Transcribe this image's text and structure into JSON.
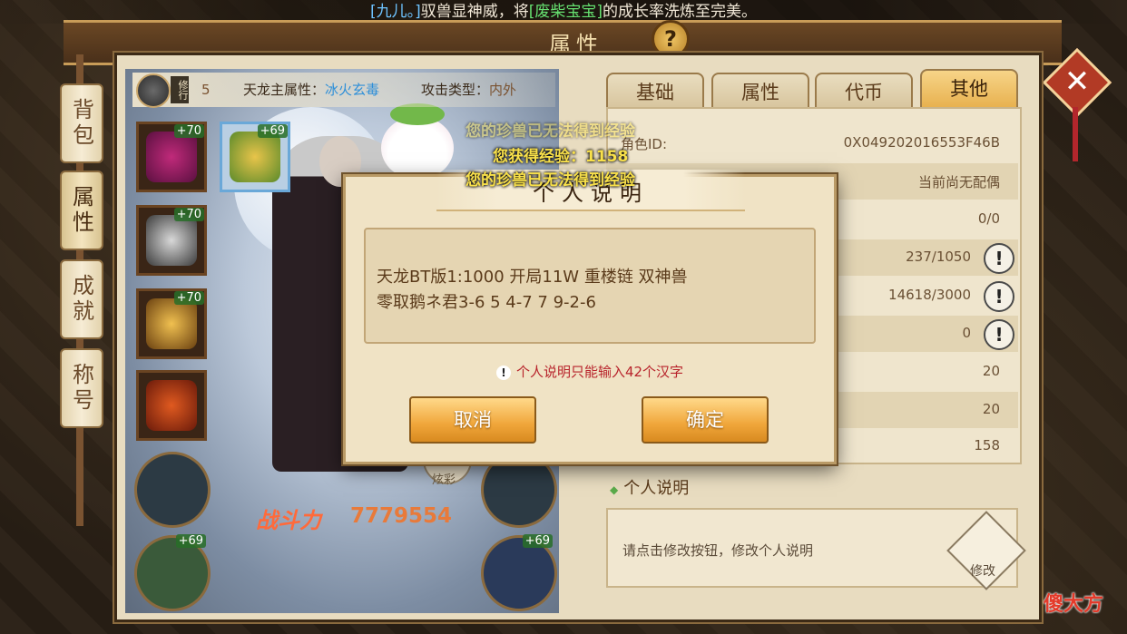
{
  "broadcast": {
    "part1": "[九儿。]",
    "part2": "驭兽显神威，将",
    "part3": "[废柴宝宝]",
    "part4": "的成长率洗炼至完美。"
  },
  "header": {
    "title": "属性"
  },
  "side_tabs": [
    "背包",
    "属性",
    "成就",
    "称号"
  ],
  "info": {
    "rank_tag": "修行",
    "rank_value": "5",
    "main_attr_label": "天龙主属性：",
    "main_attr_value": "冰火玄毒",
    "atk_type_label": "攻击类型：",
    "atk_type_value": "内外"
  },
  "equip_levels": [
    "+70",
    "+69",
    "+70",
    "+70",
    "+69",
    "+69"
  ],
  "power": {
    "label": "战斗力",
    "value": "7779554"
  },
  "skin_label": "炫彩",
  "tabs": [
    "基础",
    "属性",
    "代币",
    "其他"
  ],
  "rows": [
    {
      "label": "角色ID:",
      "value": "0X049202016553F46B"
    },
    {
      "label": "",
      "value": "当前尚无配偶"
    },
    {
      "label": "",
      "value": "0/0"
    },
    {
      "label": "",
      "value": "237/1050"
    },
    {
      "label": "",
      "value": "14618/3000"
    },
    {
      "label": "",
      "value": "0"
    },
    {
      "label": "",
      "value": "20"
    },
    {
      "label": "",
      "value": "20"
    },
    {
      "label": "",
      "value": "158"
    }
  ],
  "personal": {
    "title": "个人说明",
    "placeholder": "请点击修改按钮，修改个人说明",
    "edit_label": "修改"
  },
  "messages": {
    "faded": "您的珍兽已无法得到经验",
    "exp": "您获得经验：1158",
    "pet": "您的珍兽已无法得到经验"
  },
  "modal": {
    "title": "个人说明",
    "line1": "天龙BT版1:1000 开局11W 重楼链 双神兽",
    "line2": "零取鹅ネ君3-6 5 4-7 7 9-2-6",
    "warning": "个人说明只能输入42个汉字",
    "cancel": "取消",
    "confirm": "确定"
  },
  "watermark": "傻大方",
  "colors": {
    "accent_gold": "#f0a63a",
    "warning_red": "#b8242c",
    "attr_blue": "#2e8fd8"
  }
}
